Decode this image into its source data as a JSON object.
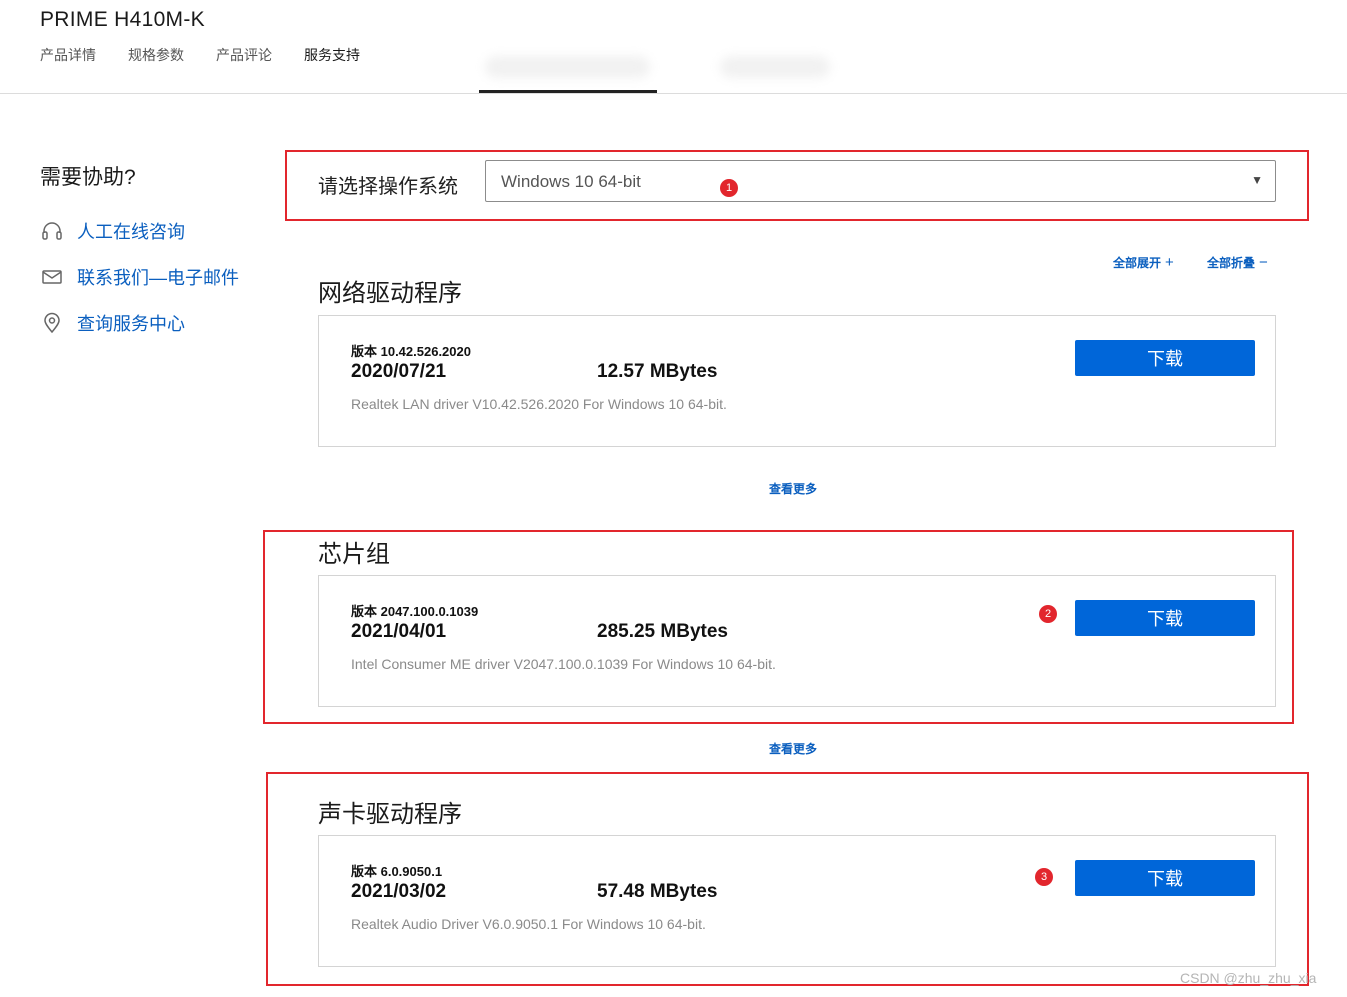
{
  "header": {
    "product_title": "PRIME H410M-K",
    "tabs": [
      {
        "label": "产品详情"
      },
      {
        "label": "规格参数"
      },
      {
        "label": "产品评论"
      },
      {
        "label": "服务支持"
      }
    ]
  },
  "sidebar": {
    "title": "需要协助?",
    "items": [
      {
        "icon": "headset-icon",
        "label": "人工在线咨询"
      },
      {
        "icon": "mail-icon",
        "label": "联系我们—电子邮件"
      },
      {
        "icon": "location-pin-icon",
        "label": "查询服务中心"
      }
    ]
  },
  "os_selector": {
    "label": "请选择操作系统",
    "value": "Windows 10 64-bit",
    "caret": "▼"
  },
  "controls": {
    "expand_all": "全部展开",
    "expand_symbol": "+",
    "collapse_all": "全部折叠",
    "collapse_symbol": "−"
  },
  "sections": [
    {
      "title": "网络驱动程序",
      "version": "版本 10.42.526.2020",
      "date": "2020/07/21",
      "size": "12.57 MBytes",
      "description": "Realtek LAN driver V10.42.526.2020 For Windows 10 64-bit.",
      "download_label": "下载",
      "see_more": "查看更多"
    },
    {
      "title": "芯片组",
      "version": "版本 2047.100.0.1039",
      "date": "2021/04/01",
      "size": "285.25 MBytes",
      "description": "Intel Consumer ME driver V2047.100.0.1039 For Windows 10 64-bit.",
      "download_label": "下载",
      "see_more": "查看更多"
    },
    {
      "title": "声卡驱动程序",
      "version": "版本 6.0.9050.1",
      "date": "2021/03/02",
      "size": "57.48 MBytes",
      "description": "Realtek Audio Driver V6.0.9050.1 For Windows 10 64-bit.",
      "download_label": "下载"
    }
  ],
  "annotations": [
    "1",
    "2",
    "3"
  ],
  "watermark": "CSDN @zhu_zhu_xia",
  "colors": {
    "link_blue": "#0b5fbf",
    "button_blue": "#0066d9",
    "annotation_red": "#e2262d"
  }
}
